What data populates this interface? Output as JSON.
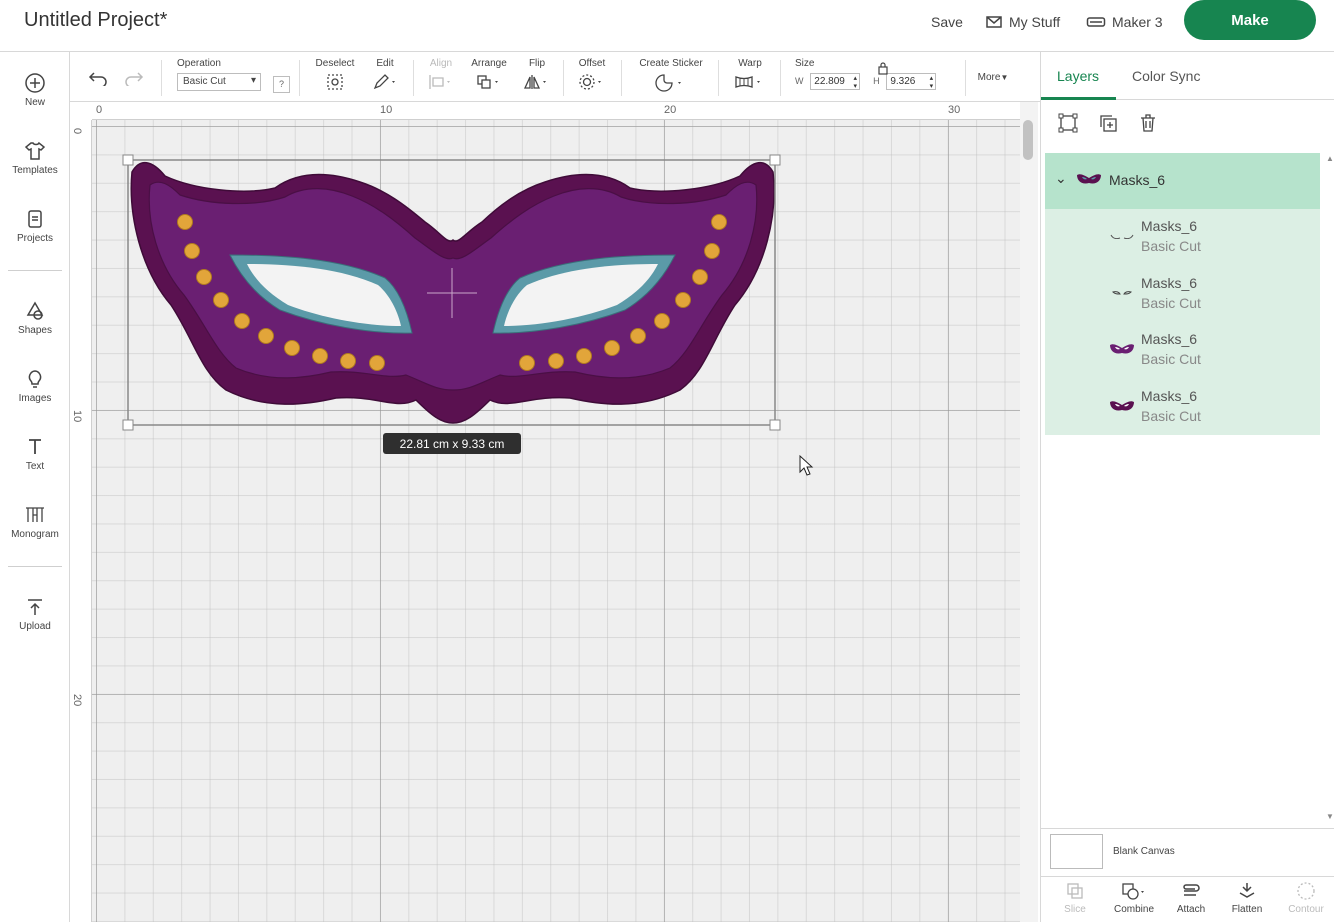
{
  "header": {
    "title": "Untitled Project*",
    "save": "Save",
    "my_stuff": "My Stuff",
    "machine": "Maker 3",
    "make": "Make"
  },
  "sidebar": {
    "items": [
      {
        "label": "New",
        "icon": "plus-circle-icon"
      },
      {
        "label": "Templates",
        "icon": "shirt-icon"
      },
      {
        "label": "Projects",
        "icon": "projects-icon"
      },
      {
        "label": "Shapes",
        "icon": "shapes-icon"
      },
      {
        "label": "Images",
        "icon": "lightbulb-icon"
      },
      {
        "label": "Text",
        "icon": "text-icon"
      },
      {
        "label": "Monogram",
        "icon": "monogram-icon"
      },
      {
        "label": "Upload",
        "icon": "upload-icon"
      }
    ]
  },
  "toolbar": {
    "operation_label": "Operation",
    "operation_value": "Basic Cut",
    "help": "?",
    "deselect": "Deselect",
    "edit": "Edit",
    "align": "Align",
    "arrange": "Arrange",
    "flip": "Flip",
    "offset": "Offset",
    "create_sticker": "Create Sticker",
    "warp": "Warp",
    "size": "Size",
    "w_label": "W",
    "w_value": "22.809",
    "h_label": "H",
    "h_value": "9.326",
    "more": "More"
  },
  "canvas": {
    "ruler_top": [
      "0",
      "10",
      "20",
      "30"
    ],
    "ruler_left": [
      "0",
      "10",
      "20"
    ],
    "dimensions": "22.81  cm x 9.33  cm"
  },
  "layers_panel": {
    "tabs": [
      "Layers",
      "Color Sync"
    ],
    "group": {
      "name": "Masks_6"
    },
    "children": [
      {
        "name": "Masks_6",
        "operation": "Basic Cut"
      },
      {
        "name": "Masks_6",
        "operation": "Basic Cut"
      },
      {
        "name": "Masks_6",
        "operation": "Basic Cut"
      },
      {
        "name": "Masks_6",
        "operation": "Basic Cut"
      }
    ],
    "blank_canvas": "Blank Canvas",
    "bottom_tools": [
      "Slice",
      "Combine",
      "Attach",
      "Flatten",
      "Contour"
    ]
  },
  "colors": {
    "accent": "#178550",
    "mask_outer": "#5a1150",
    "mask_inner": "#6a1f72",
    "mask_trim": "#5b9aa8",
    "dots": "#e2a53a"
  }
}
